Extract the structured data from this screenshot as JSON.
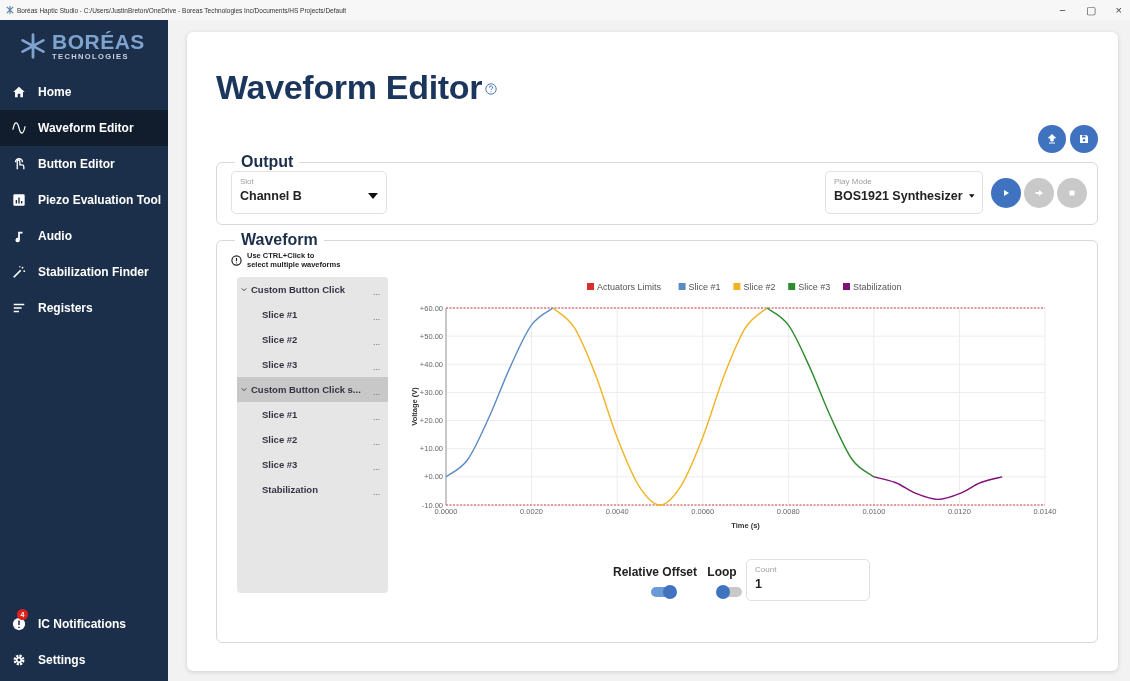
{
  "window": {
    "title": "Boréas Haptic Studio - C:/Users/JustinBreton/OneDrive - Boreas Technologies Inc/Documents/HS Projects/Default",
    "controls": [
      "−",
      "▢",
      "×"
    ]
  },
  "brand": {
    "name": "BORÉAS",
    "tagline": "TECHNOLOGIES"
  },
  "sidebar": {
    "items": [
      {
        "label": "Home",
        "kind": "home",
        "selected": false
      },
      {
        "label": "Waveform Editor",
        "kind": "wave",
        "selected": true
      },
      {
        "label": "Button Editor",
        "kind": "touch",
        "selected": false
      },
      {
        "label": "Piezo Evaluation Tool",
        "kind": "chart",
        "selected": false
      },
      {
        "label": "Audio",
        "kind": "note",
        "selected": false
      },
      {
        "label": "Stabilization Finder",
        "kind": "wand",
        "selected": false
      },
      {
        "label": "Registers",
        "kind": "lines",
        "selected": false
      }
    ],
    "bottom_items": [
      {
        "label": "IC Notifications",
        "kind": "alert",
        "badge": "4",
        "selected": false
      },
      {
        "label": "Settings",
        "kind": "gear",
        "selected": false
      }
    ]
  },
  "page": {
    "title": "Waveform Editor",
    "actions": [
      {
        "kind": "upload"
      },
      {
        "kind": "save"
      }
    ]
  },
  "output": {
    "title": "Output",
    "slot": {
      "label": "Slot",
      "value": "Channel B"
    },
    "play_mode": {
      "label": "Play Mode",
      "value": "BOS1921 Synthesizer"
    },
    "controls": [
      {
        "kind": "play",
        "disabled": false
      },
      {
        "kind": "next",
        "disabled": true
      },
      {
        "kind": "stop",
        "disabled": true
      }
    ]
  },
  "waveform": {
    "title": "Waveform",
    "hint": "Use CTRL+Click to\nselect multiple waveforms",
    "tree": [
      {
        "label": "Custom Button Click",
        "menu": "...",
        "expanded": true,
        "selected": false,
        "children": [
          {
            "label": "Slice #1",
            "menu": "...",
            "selected": false
          },
          {
            "label": "Slice #2",
            "menu": "...",
            "selected": false
          },
          {
            "label": "Slice #3",
            "menu": "...",
            "selected": false
          }
        ]
      },
      {
        "label": "Custom Button Click s...",
        "menu": "...",
        "expanded": true,
        "selected": true,
        "children": [
          {
            "label": "Slice #1",
            "menu": "...",
            "selected": false
          },
          {
            "label": "Slice #2",
            "menu": "...",
            "selected": false
          },
          {
            "label": "Slice #3",
            "menu": "...",
            "selected": false
          },
          {
            "label": "Stabilization",
            "menu": "...",
            "selected": false
          }
        ]
      }
    ],
    "chart_data": {
      "type": "line",
      "xlabel": "Time (s)",
      "ylabel": "Voltage (V)",
      "xlim": [
        0,
        0.014
      ],
      "ylim": [
        -10,
        60
      ],
      "grid": true,
      "legend": true,
      "xticks": [
        {
          "value": 0,
          "label": "0.0000"
        },
        {
          "value": 0.002,
          "label": "0.0020"
        },
        {
          "value": 0.004,
          "label": "0.0040"
        },
        {
          "value": 0.006,
          "label": "0.0060"
        },
        {
          "value": 0.008,
          "label": "0.0080"
        },
        {
          "value": 0.01,
          "label": "0.0100"
        },
        {
          "value": 0.012,
          "label": "0.0120"
        },
        {
          "value": 0.014,
          "label": "0.0140"
        }
      ],
      "yticks": [
        {
          "value": 60,
          "label": "+60.00"
        },
        {
          "value": 50,
          "label": "+50.00"
        },
        {
          "value": 40,
          "label": "+40.00"
        },
        {
          "value": 30,
          "label": "+30.00"
        },
        {
          "value": 20,
          "label": "+20.00"
        },
        {
          "value": 10,
          "label": "+10.00"
        },
        {
          "value": 0,
          "label": "+0.00"
        },
        {
          "value": -10,
          "label": "-10.00"
        }
      ],
      "ref_lines": [
        {
          "axis": "y",
          "value": 60,
          "label": "Actuators Limits",
          "color": "#d32f2f",
          "line_style": "dashed"
        },
        {
          "axis": "y",
          "value": -10,
          "color": "#d32f2f",
          "line_style": "dashed"
        }
      ],
      "x": [
        0,
        0.0005,
        0.001,
        0.0015,
        0.002,
        0.0025,
        0.003,
        0.0035,
        0.004,
        0.0045,
        0.005,
        0.0055,
        0.006,
        0.0065,
        0.007,
        0.0075,
        0.008,
        0.0085,
        0.009,
        0.0095,
        0.01,
        0.0105,
        0.011,
        0.0115,
        0.012,
        0.0125,
        0.013
      ],
      "series": [
        {
          "name": "Slice #1",
          "color": "#5b8bc4",
          "line_style": "solid",
          "values": [
            0,
            6,
            21,
            39,
            54,
            60,
            null,
            null,
            null,
            null,
            null,
            null,
            null,
            null,
            null,
            null,
            null,
            null,
            null,
            null,
            null,
            null,
            null,
            null,
            null,
            null,
            null
          ]
        },
        {
          "name": "Slice #2",
          "color": "#f0b323",
          "line_style": "solid",
          "values": [
            null,
            null,
            null,
            null,
            null,
            60,
            53,
            36,
            14,
            -3,
            -10,
            -3,
            14,
            36,
            53,
            60,
            null,
            null,
            null,
            null,
            null,
            null,
            null,
            null,
            null,
            null,
            null
          ]
        },
        {
          "name": "Slice #3",
          "color": "#2e8b2e",
          "line_style": "solid",
          "values": [
            null,
            null,
            null,
            null,
            null,
            null,
            null,
            null,
            null,
            null,
            null,
            null,
            null,
            null,
            null,
            60,
            54,
            39,
            21,
            6,
            0,
            null,
            null,
            null,
            null,
            null,
            null
          ]
        },
        {
          "name": "Stabilization",
          "color": "#800f7a",
          "line_style": "solid",
          "values": [
            null,
            null,
            null,
            null,
            null,
            null,
            null,
            null,
            null,
            null,
            null,
            null,
            null,
            null,
            null,
            null,
            null,
            null,
            null,
            null,
            0,
            -2,
            -6,
            -8,
            -6,
            -2,
            0
          ]
        }
      ]
    },
    "relative_offset": {
      "label": "Relative Offset",
      "on": true
    },
    "loop": {
      "label": "Loop",
      "on": false
    },
    "count": {
      "label": "Count",
      "value": "1"
    }
  }
}
